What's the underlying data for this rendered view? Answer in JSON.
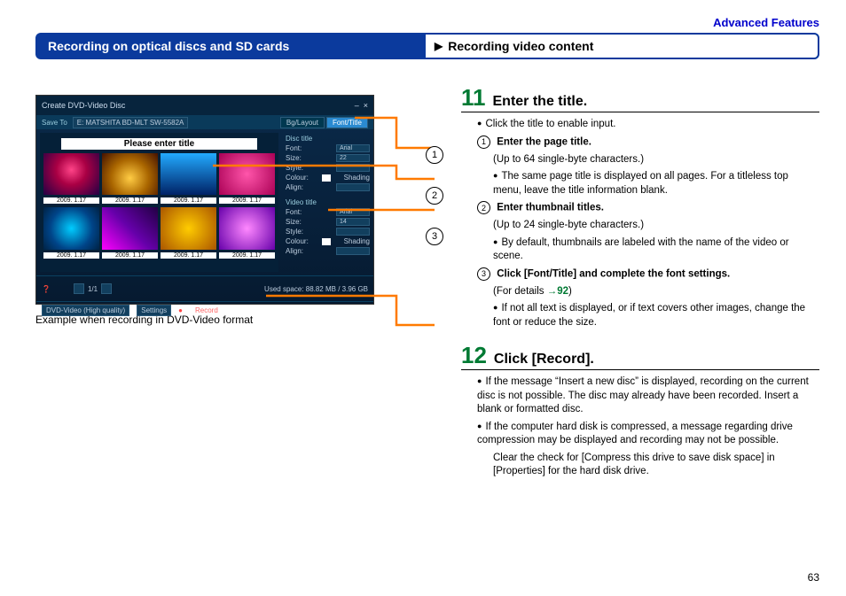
{
  "section_header": "Advanced Features",
  "bluebar_left": "Recording on optical discs and SD cards",
  "bluebar_right": "Recording video content",
  "screenshot": {
    "window_title": "Create DVD-Video Disc",
    "save_to_label": "Save To",
    "drive": "E: MATSHITA BD-MLT SW-5582A",
    "tab_layout": "Bg/Layout",
    "tab_font": "Font/Title",
    "enter_title": "Please enter title",
    "thumb_date": "2009. 1.17",
    "side": {
      "disc_title_hdr": "Disc title",
      "video_title_hdr": "Video title",
      "font_label": "Font:",
      "font_value": "Arial",
      "size_label": "Size:",
      "size_disc": "22",
      "size_video": "14",
      "style_label": "Style:",
      "colour_label": "Colour:",
      "shading_label": "Shading",
      "align_label": "Align:"
    },
    "footer": {
      "pager": "1/1",
      "used_space": "Used space:  88.82 MB / 3.96 GB"
    },
    "bottom": {
      "format": "DVD-Video (High quality)",
      "settings": "Settings",
      "record": "Record"
    }
  },
  "caption": "Example when recording in DVD-Video format",
  "callouts": {
    "m1": "1",
    "m2": "2",
    "m3": "3"
  },
  "step11": {
    "num": "11",
    "title": "Enter the title.",
    "b1": "Click the title to enable input.",
    "c1_label": "1",
    "c1_title": "Enter the page title.",
    "c1_note": "(Up to 64 single-byte characters.)",
    "c1_sub": "The same page title is displayed on all pages. For a titleless top menu, leave the title information blank.",
    "c2_label": "2",
    "c2_title": "Enter thumbnail titles.",
    "c2_note": "(Up to 24 single-byte characters.)",
    "c2_sub": "By default, thumbnails are labeled with the name of the video or scene.",
    "c3_label": "3",
    "c3_title": "Click [Font/Title] and complete the font settings.",
    "c3_note_before": "(For details ",
    "c3_link": "→92",
    "c3_note_after": ")",
    "c3_sub": "If not all text is displayed, or if text covers other images, change the font or reduce the size."
  },
  "step12": {
    "num": "12",
    "title": "Click [Record].",
    "b1": "If the message “Insert a new disc” is displayed, recording on the current disc is not possible. The disc may already have been recorded. Insert a blank or formatted disc.",
    "b2": "If the computer hard disk is compressed, a message regarding drive compression may be displayed and recording may not be possible.",
    "b2_sub": "Clear the check for [Compress this drive to save disk space] in [Properties] for the hard disk drive."
  },
  "page_number": "63"
}
